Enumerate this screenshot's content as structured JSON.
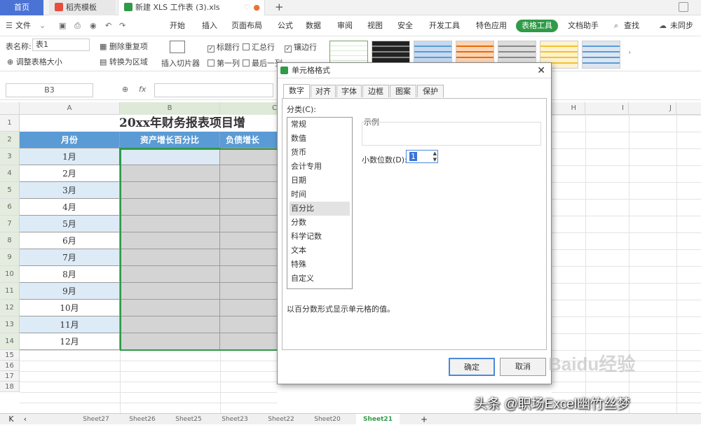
{
  "titlebar": {
    "home_tab": "首页",
    "doc_tab": "稻壳模板",
    "current_tab": "新建 XLS 工作表 (3).xls",
    "new_tab": "+"
  },
  "menubar": {
    "file": "文件",
    "items": [
      "开始",
      "插入",
      "页面布局",
      "公式",
      "数据",
      "审阅",
      "视图",
      "安全",
      "开发工具",
      "特色应用",
      "表格工具",
      "文档助手"
    ],
    "active": "表格工具",
    "search": "查找",
    "unsync": "未同步"
  },
  "ribbon": {
    "table_name_label": "表名称:",
    "table_name_value": "表1",
    "resize_table": "调整表格大小",
    "remove_duplicates": "删除重复项",
    "convert_to_range": "转换为区域",
    "insert_slicer": "插入切片器",
    "header_row": "标题行",
    "total_row": "汇总行",
    "banded_rows": "镶边行",
    "first_column": "第一列",
    "last_column": "最后一列"
  },
  "formulabar": {
    "namebox": "B3",
    "fx": "fx"
  },
  "grid": {
    "col_headers": [
      "A",
      "B",
      "C",
      "H",
      "I",
      "J"
    ],
    "row_headers": [
      "1",
      "2",
      "3",
      "4",
      "5",
      "6",
      "7",
      "8",
      "9",
      "10",
      "11",
      "12",
      "13",
      "14",
      "15",
      "16",
      "17",
      "18"
    ],
    "title": "20xx年财务报表项目增",
    "headers": [
      "月份",
      "资产增长百分比",
      "负债增长"
    ],
    "months": [
      "1月",
      "2月",
      "3月",
      "4月",
      "5月",
      "6月",
      "7月",
      "8月",
      "9月",
      "10月",
      "11月",
      "12月"
    ]
  },
  "sheets": {
    "tabs": [
      "Sheet27",
      "Sheet26",
      "Sheet25",
      "Sheet23",
      "Sheet22",
      "Sheet20",
      "Sheet21"
    ],
    "active": "Sheet21",
    "add": "+"
  },
  "dialog": {
    "title": "单元格格式",
    "tabs": [
      "数字",
      "对齐",
      "字体",
      "边框",
      "图案",
      "保护"
    ],
    "category_label": "分类(C):",
    "categories": [
      "常规",
      "数值",
      "货币",
      "会计专用",
      "日期",
      "时间",
      "百分比",
      "分数",
      "科学记数",
      "文本",
      "特殊",
      "自定义"
    ],
    "selected_category": "百分比",
    "sample_label": "示例",
    "decimal_label": "小数位数(D):",
    "decimal_value": "1",
    "description": "以百分数形式显示单元格的值。",
    "ok": "确定",
    "cancel": "取消"
  },
  "watermark": {
    "author": "头条 @职场Excel幽竹丝梦",
    "logo": "Baidu经验"
  },
  "colors": {
    "header_blue": "#5b9bd5",
    "band_blue": "#ddebf7",
    "selected_gray": "#d4d4d4",
    "accent_green": "#2f9a47"
  }
}
